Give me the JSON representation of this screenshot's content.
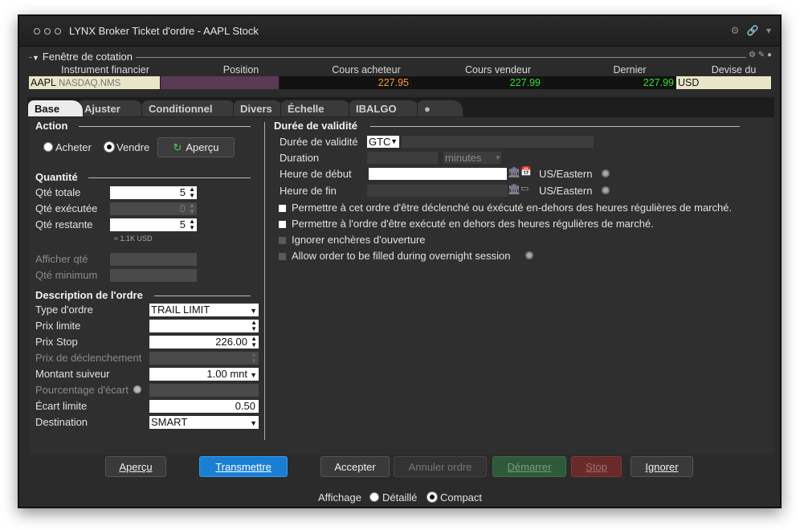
{
  "window": {
    "title": "LYNX Broker  Ticket d'ordre - AAPL Stock"
  },
  "quote": {
    "panel_title": "Fenêtre de cotation",
    "headers": [
      "Instrument financier",
      "Position",
      "Cours acheteur",
      "Cours vendeur",
      "Dernier",
      "Devise du trading"
    ],
    "symbol": "AAPL",
    "exchange": "NASDAQ.NMS",
    "position": "",
    "bid": "227.95",
    "ask": "227.99",
    "last": "227.99",
    "currency": "USD",
    "colors": {
      "bid": "#ff9933",
      "ask": "#33dd33",
      "last": "#33dd33"
    }
  },
  "tabs": [
    "Base",
    "Ajuster",
    "Conditionnel",
    "Divers",
    "Échelle",
    "IBALGO"
  ],
  "action": {
    "title": "Action",
    "buy": "Acheter",
    "sell": "Vendre",
    "preview": "Aperçu",
    "selected": "sell"
  },
  "quantity": {
    "title": "Quantité",
    "total_label": "Qté totale",
    "total": "5",
    "exec_label": "Qté exécutée",
    "exec": "0",
    "remaining_label": "Qté restante",
    "remaining": "5",
    "hint": "≈ 1.1K USD",
    "display_label": "Afficher qté",
    "min_label": "Qté minimum"
  },
  "order": {
    "title": "Description de l'ordre",
    "type_label": "Type d'ordre",
    "type": "TRAIL LIMIT",
    "limit_label": "Prix limite",
    "limit": "",
    "stop_label": "Prix Stop",
    "stop": "226.00",
    "trigger_label": "Prix de déclenchement",
    "trail_label": "Montant suiveur",
    "trail": "1.00 mnt",
    "pct_label": "Pourcentage d'écart",
    "offset_label": "Écart limite",
    "offset": "0.50",
    "dest_label": "Destination",
    "dest": "SMART"
  },
  "validity": {
    "title": "Durée de validité",
    "tif_label": "Durée de validité",
    "tif": "GTC",
    "duration_label": "Duration",
    "duration_unit": "minutes",
    "start_label": "Heure de début",
    "end_label": "Heure de fin",
    "tz": "US/Eastern",
    "opt1": "Permettre à cet ordre d'être déclenché ou éxécuté en-dehors des heures régulières de marché.",
    "opt2": "Permettre à l'ordre d'être exécuté en dehors des heures régulières de marché.",
    "opt3": "Ignorer enchères d'ouverture",
    "opt4": "Allow order to be filled during overnight session"
  },
  "buttons": {
    "preview": "Aperçu",
    "transmit": "Transmettre",
    "accept": "Accepter",
    "cancel": "Annuler ordre",
    "start": "Démarrer",
    "stop": "Stop",
    "ignore": "Ignorer"
  },
  "display": {
    "label": "Affichage",
    "detailed": "Détaillé",
    "compact": "Compact",
    "selected": "compact"
  },
  "colors": {
    "transmit": "#1a7fd4",
    "start": "#2e5a3a",
    "stop": "#6a2a2a"
  }
}
